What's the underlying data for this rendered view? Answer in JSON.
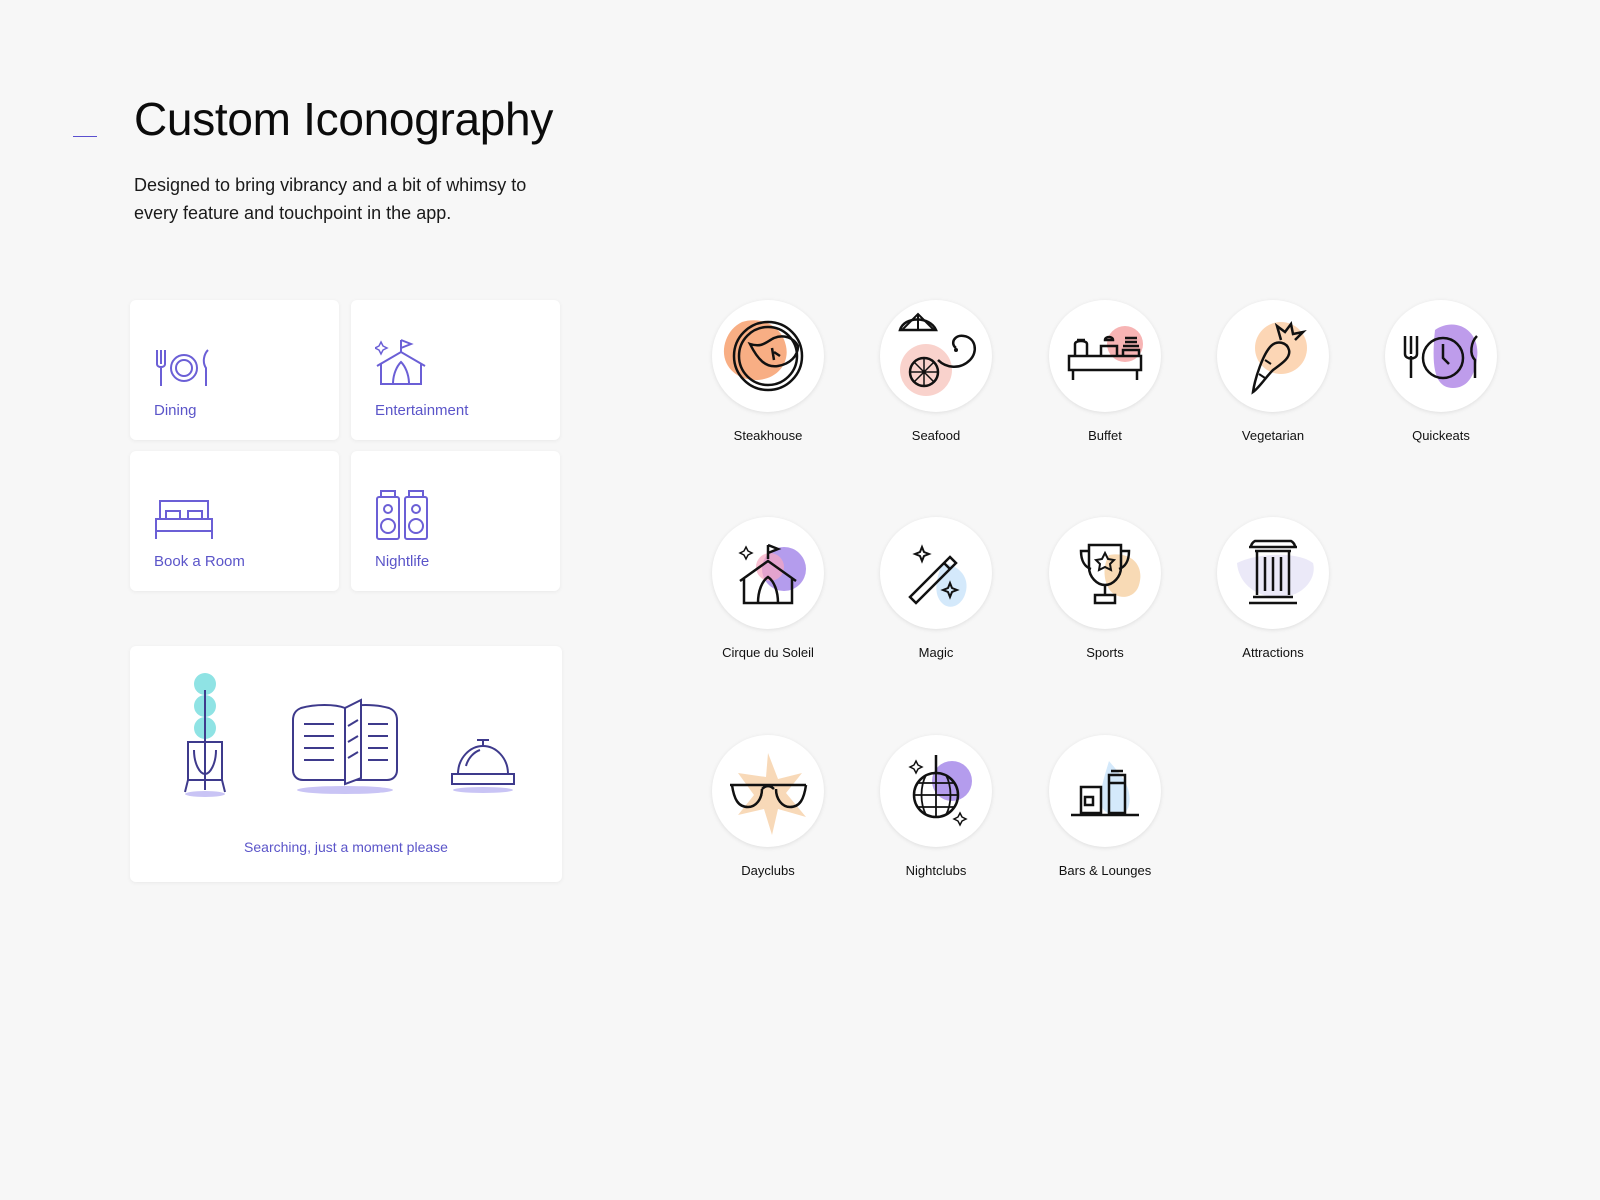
{
  "page": {
    "title": "Custom Iconography",
    "subtitle": "Designed to bring vibrancy and a bit of whimsy to every feature and touchpoint in the app."
  },
  "features": [
    {
      "label": "Dining",
      "icon": "dining-icon"
    },
    {
      "label": "Entertainment",
      "icon": "circus-tent-icon"
    },
    {
      "label": "Book a Room",
      "icon": "bed-icon"
    },
    {
      "label": "Nightlife",
      "icon": "speakers-icon"
    }
  ],
  "search": {
    "text": "Searching, just a moment please",
    "icons": [
      "plant-icon",
      "menu-book-icon",
      "service-bell-icon"
    ]
  },
  "categories": [
    {
      "label": "Steakhouse",
      "icon": "steak-icon"
    },
    {
      "label": "Seafood",
      "icon": "shrimp-icon"
    },
    {
      "label": "Buffet",
      "icon": "buffet-icon"
    },
    {
      "label": "Vegetarian",
      "icon": "carrot-icon"
    },
    {
      "label": "Quickeats",
      "icon": "plate-clock-icon"
    },
    {
      "label": "Cirque du Soleil",
      "icon": "circus-tent-icon"
    },
    {
      "label": "Magic",
      "icon": "magic-wand-icon"
    },
    {
      "label": "Sports",
      "icon": "trophy-icon"
    },
    {
      "label": "Attractions",
      "icon": "column-icon"
    },
    {
      "label": "Dayclubs",
      "icon": "sunglasses-icon"
    },
    {
      "label": "Nightclubs",
      "icon": "disco-ball-icon"
    },
    {
      "label": "Bars & Lounges",
      "icon": "drinks-icon"
    }
  ],
  "colors": {
    "accent": "#5b55c9",
    "background": "#f7f7f7",
    "card": "#ffffff"
  }
}
